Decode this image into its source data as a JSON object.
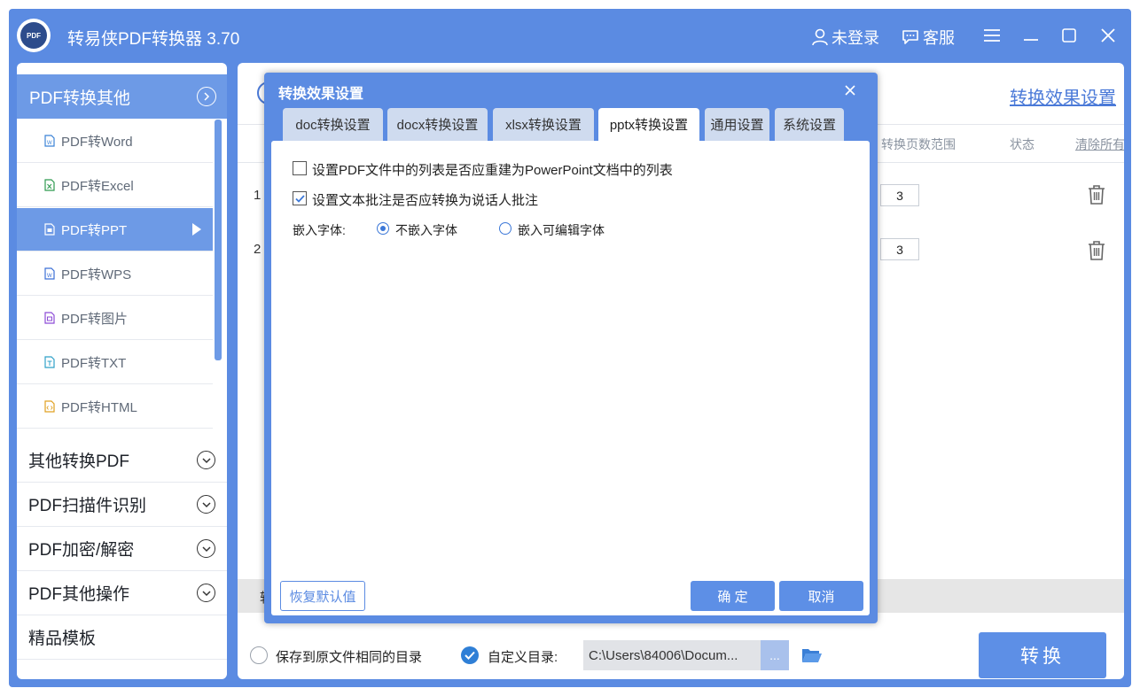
{
  "window": {
    "title": "转易侠PDF转换器 3.70",
    "logo_text": "PDF",
    "login_label": "未登录",
    "service_label": "客服"
  },
  "sidebar": {
    "header_label": "PDF转换其他",
    "sub_items": [
      {
        "label": "PDF转Word",
        "icon": "word-file-icon",
        "color": "#3b82d6"
      },
      {
        "label": "PDF转Excel",
        "icon": "excel-file-icon",
        "color": "#2e9a4f"
      },
      {
        "label": "PDF转PPT",
        "icon": "ppt-file-icon",
        "color": "#ffffff"
      },
      {
        "label": "PDF转WPS",
        "icon": "wps-file-icon",
        "color": "#3b6fd6"
      },
      {
        "label": "PDF转图片",
        "icon": "image-file-icon",
        "color": "#8c4bd6"
      },
      {
        "label": "PDF转TXT",
        "icon": "txt-file-icon",
        "color": "#2fa0c8"
      },
      {
        "label": "PDF转HTML",
        "icon": "html-file-icon",
        "color": "#e0a020"
      }
    ],
    "categories": [
      {
        "label": "其他转换PDF"
      },
      {
        "label": "PDF扫描件识别"
      },
      {
        "label": "PDF加密/解密"
      },
      {
        "label": "PDF其他操作"
      },
      {
        "label": "精品模板"
      }
    ]
  },
  "main": {
    "settings_link": "转换效果设置",
    "columns": {
      "page_range": "转换页数范围",
      "status": "状态",
      "clear_all": "清除所有"
    },
    "rows": [
      {
        "index": "1",
        "pages": "3"
      },
      {
        "index": "2",
        "pages": "3"
      }
    ],
    "strip_label": "转",
    "save_same_dir_label": "保存到原文件相同的目录",
    "custom_dir_label": "自定义目录:",
    "path_value": "C:\\Users\\84006\\Docum...",
    "browse_label": "...",
    "convert_label": "转换"
  },
  "dialog": {
    "title": "转换效果设置",
    "tabs": [
      "doc转换设置",
      "docx转换设置",
      "xlsx转换设置",
      "pptx转换设置",
      "通用设置",
      "系统设置"
    ],
    "active_tab": "pptx转换设置",
    "options": {
      "rebuild_lists_label": "设置PDF文件中的列表是否应重建为PowerPoint文档中的列表",
      "rebuild_lists_checked": false,
      "annotations_label": "设置文本批注是否应转换为说话人批注",
      "annotations_checked": true
    },
    "embed_font_label": "嵌入字体:",
    "embed_options": [
      {
        "label": "不嵌入字体",
        "selected": true
      },
      {
        "label": "嵌入可编辑字体",
        "selected": false
      }
    ],
    "restore_label": "恢复默认值",
    "ok_label": "确 定",
    "cancel_label": "取消"
  },
  "colors": {
    "primary": "#5b8be2",
    "accent_button": "#5d8fe6",
    "sidebar_active": "#6d9ae6"
  }
}
